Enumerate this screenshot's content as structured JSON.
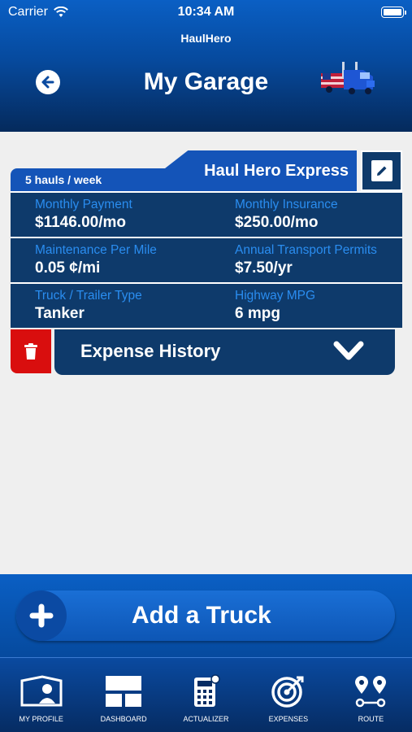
{
  "status": {
    "carrier": "Carrier",
    "time": "10:34 AM"
  },
  "app": {
    "name": "HaulHero"
  },
  "header": {
    "title": "My Garage"
  },
  "truck_card": {
    "hauls": "5 hauls / week",
    "name": "Haul Hero Express",
    "monthly_payment_label": "Monthly Payment",
    "monthly_payment_value": "$1146.00/mo",
    "monthly_insurance_label": "Monthly Insurance",
    "monthly_insurance_value": "$250.00/mo",
    "maintenance_label": "Maintenance Per Mile",
    "maintenance_value": "0.05 ¢/mi",
    "permits_label": "Annual Transport Permits",
    "permits_value": "$7.50/yr",
    "type_label": "Truck / Trailer Type",
    "type_value": "Tanker",
    "mpg_label": "Highway MPG",
    "mpg_value": "6 mpg",
    "expense_history": "Expense History"
  },
  "add_truck": {
    "label": "Add a Truck"
  },
  "tabbar": [
    {
      "label": "MY PROFILE"
    },
    {
      "label": "DASHBOARD"
    },
    {
      "label": "ACTUALIZER"
    },
    {
      "label": "EXPENSES"
    },
    {
      "label": "ROUTE"
    }
  ],
  "colors": {
    "primary": "#0a5fc4",
    "card": "#0e3a6b",
    "accent_label": "#2a8df0",
    "danger": "#d90e0e"
  }
}
